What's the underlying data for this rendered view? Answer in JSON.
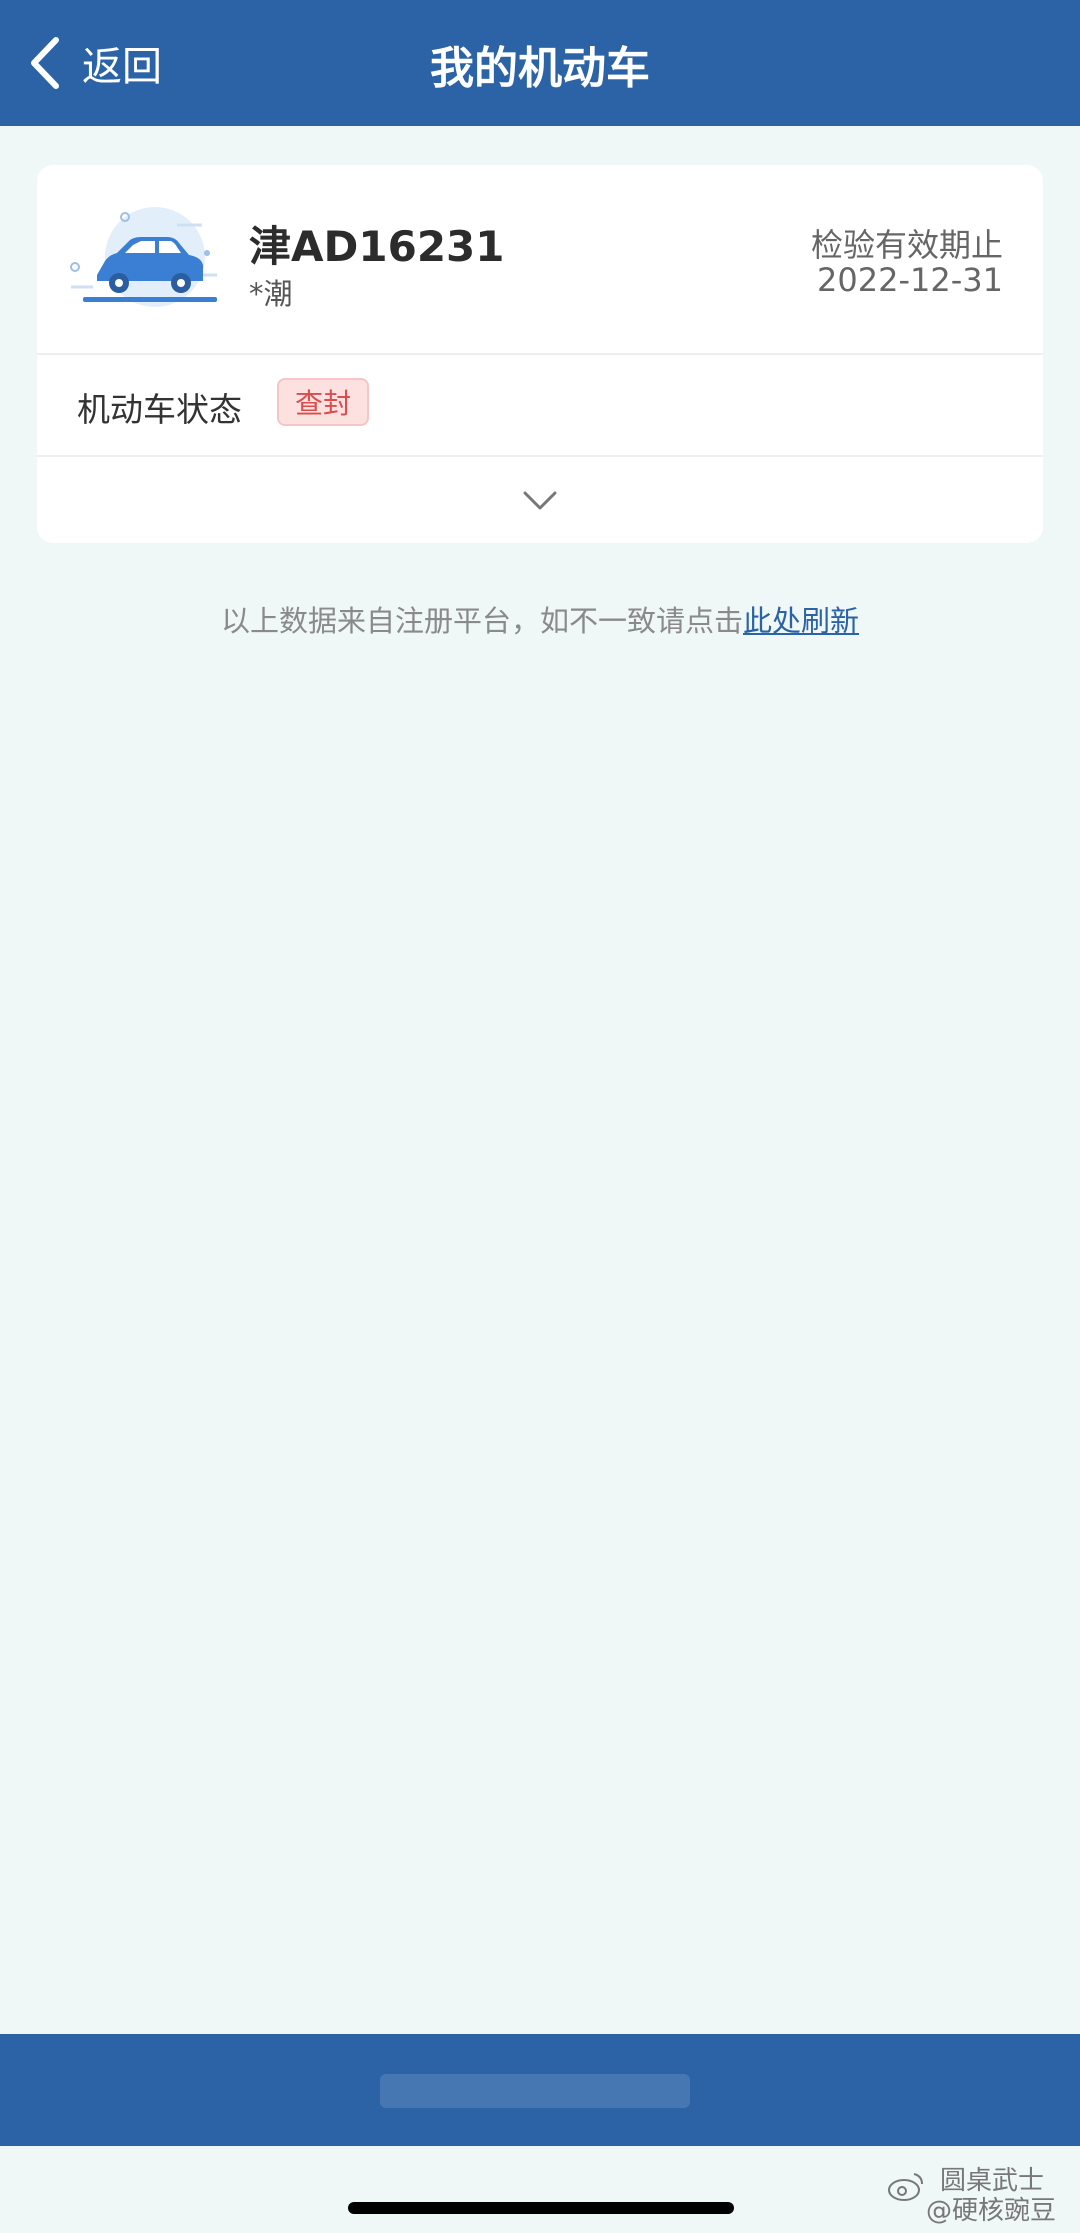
{
  "navbar": {
    "back_label": "返回",
    "title": "我的机动车"
  },
  "vehicle": {
    "plate": "津AD16231",
    "owner": "*潮",
    "inspection_label": "检验有效期止",
    "inspection_date": "2022-12-31",
    "status_label": "机动车状态",
    "status_value": "查封"
  },
  "note": {
    "text": "以上数据来自注册平台，如不一致请点击",
    "link": "此处刷新"
  },
  "watermark": {
    "line1": "圆桌武士",
    "line2": "@硬核豌豆"
  },
  "colors": {
    "primary": "#2b63a6",
    "background": "#eff7f7",
    "badge_bg": "#fde1e1",
    "badge_text": "#d94d4d"
  },
  "icons": {
    "back": "chevron-left-icon",
    "car": "car-illustration",
    "expand": "chevron-down-icon"
  }
}
